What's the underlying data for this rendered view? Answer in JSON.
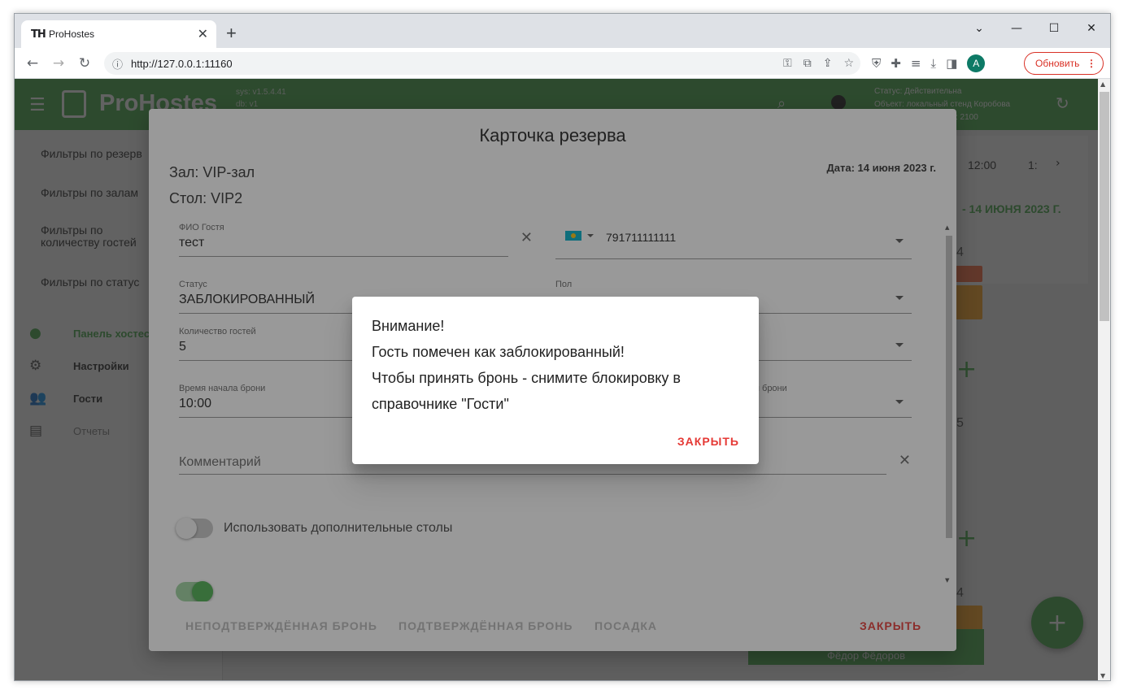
{
  "browser": {
    "tab_title": "ProHostes",
    "tab_favicon": "TH",
    "url": "http://127.0.0.1:11160",
    "update_label": "Обновить",
    "avatar_letter": "A"
  },
  "app": {
    "brand": "ProHostes",
    "version_line1": "sys: v1.5.4.41",
    "version_line2": "db: v1",
    "status_line1": "Статус: Действительна",
    "status_line2": "Объект: локальный стенд Коробова",
    "status_line3": "ID: 2100",
    "sidebar": {
      "filters": [
        "Фильтры по резерв",
        "Фильтры по залам",
        "Фильтры по количеству гостей",
        "Фильтры по статус"
      ],
      "nav": [
        {
          "label": "Панель хостес",
          "icon": "clock-icon"
        },
        {
          "label": "Настройки",
          "icon": "gear-icon"
        },
        {
          "label": "Гости",
          "icon": "people-icon"
        },
        {
          "label": "Отчеты",
          "icon": "report-icon"
        }
      ]
    },
    "timeline": {
      "time1": "12:00",
      "time2": "1:",
      "date": "- 14 ИЮНЯ 2023 Г."
    },
    "tables": [
      {
        "count": "4"
      },
      {
        "count": "5"
      },
      {
        "count": "4"
      }
    ],
    "green_card_name": "Фёдор Фёдоров",
    "colors": {
      "accent": "#4caf50",
      "danger": "#e53935"
    }
  },
  "reservation": {
    "title": "Карточка резерва",
    "hall": "Зал: VIP-зал",
    "table": "Стол: VIP2",
    "date": "Дата: 14 июня 2023 г.",
    "guest_label": "ФИО Гостя",
    "guest_value": "тест",
    "phone_value": "791711111111",
    "status_label": "Статус",
    "status_value": "ЗАБЛОКИРОВАННЫЙ",
    "gender_label": "Пол",
    "guests_label": "Количество гостей",
    "guests_value": "5",
    "start_label": "Время начала брони",
    "start_value": "10:00",
    "end_label_partial": "я брони",
    "comment_placeholder": "Комментарий",
    "toggle1_label": "Использовать дополнительные столы",
    "actions": {
      "unconfirmed": "НЕПОДТВЕРЖДЁННАЯ БРОНЬ",
      "confirmed": "ПОДТВЕРЖДЁННАЯ БРОНЬ",
      "seating": "ПОСАДКА",
      "close": "ЗАКРЫТЬ"
    }
  },
  "alert": {
    "line1": "Внимание!",
    "line2": "Гость помечен как заблокированный!",
    "line3": "Чтобы принять бронь - снимите блокировку в",
    "line4": "справочнике \"Гости\"",
    "close": "ЗАКРЫТЬ"
  }
}
